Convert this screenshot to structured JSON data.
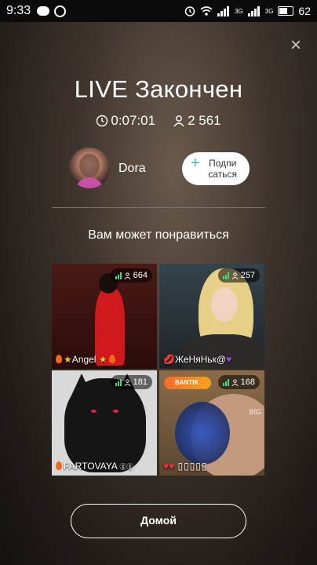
{
  "statusbar": {
    "time": "9:33",
    "net1": "3G",
    "net2": "3G",
    "battery": "62"
  },
  "stream": {
    "title": "LIVE Закончен",
    "duration": "0:07:01",
    "viewers": "2 561"
  },
  "host": {
    "name": "Dora",
    "subscribe_label": "Подпи саться"
  },
  "suggestions": {
    "heading": "Вам может понравиться",
    "cards": [
      {
        "name": "Angel",
        "viewers": "664"
      },
      {
        "name": "ЖеНяНьк@",
        "viewers": "257"
      },
      {
        "name": "FARTOVAYA",
        "viewers": "181"
      },
      {
        "name": "",
        "viewers": "168",
        "banner": "BANTIK",
        "tag": "BIG"
      }
    ]
  },
  "footer": {
    "home_label": "Домой"
  },
  "icons": {
    "close": "close-icon",
    "clock": "clock-icon",
    "person": "person-icon",
    "plus": "plus-icon"
  },
  "colors": {
    "accent": "#2fc4a8",
    "signal": "#3fdb7c"
  }
}
